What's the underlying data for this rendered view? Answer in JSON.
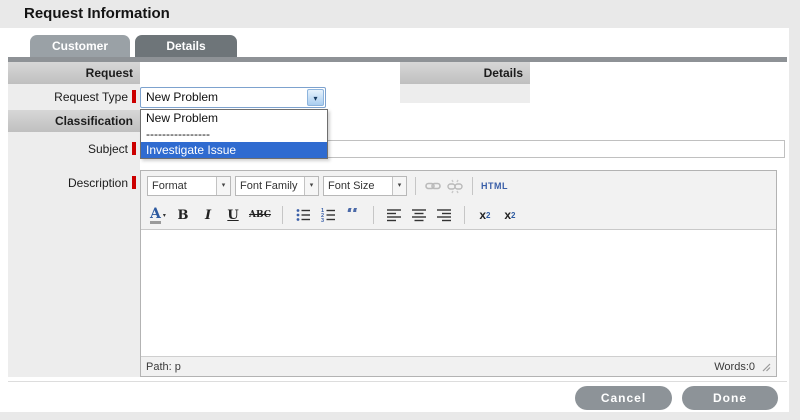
{
  "titlebar": {
    "title": "Request Information"
  },
  "tabs": {
    "customer": "Customer",
    "details": "Details"
  },
  "sections": {
    "request": "Request",
    "details": "Details",
    "classification": "Classification"
  },
  "fields": {
    "request_type": {
      "label": "Request Type",
      "value": "New Problem"
    },
    "subject": {
      "label": "Subject",
      "value": ""
    },
    "description": {
      "label": "Description"
    }
  },
  "request_type_dropdown": {
    "options": [
      "New Problem",
      "----------------",
      "Investigate Issue"
    ],
    "highlighted": "Investigate Issue"
  },
  "editor": {
    "format_select": "Format",
    "font_family_select": "Font Family",
    "font_size_select": "Font Size",
    "html_label": "HTML",
    "color_letter": "A",
    "bold": "B",
    "italic": "I",
    "underline": "U",
    "strike": "ABC",
    "quote_glyph": "“",
    "sub_base": "x",
    "sub_num": "2",
    "sup_base": "x",
    "sup_num": "2",
    "status": {
      "path": "Path: p",
      "words": "Words:0"
    }
  },
  "icons": {
    "dropdown_arrow": "▾"
  },
  "footer": {
    "cancel": "Cancel",
    "done": "Done"
  },
  "colors": {
    "tab_active": "#9aa1a6",
    "tab_inactive": "#6e7579",
    "highlight_blue": "#2f6bd0",
    "required_red": "#cc0000",
    "button_gray": "#8d9398",
    "select_border_blue": "#7da2ce"
  }
}
